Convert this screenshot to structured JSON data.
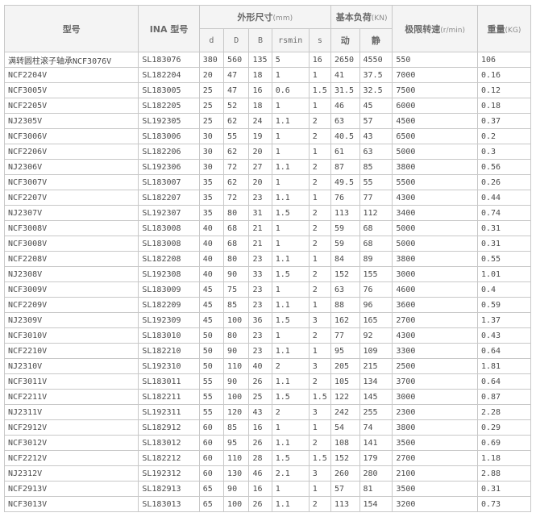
{
  "headers": {
    "model": "型号",
    "ina_model": "INA 型号",
    "dimensions": "外形尺寸",
    "dimensions_unit": "(mm)",
    "load": "基本负荷",
    "load_unit": "(KN)",
    "speed": "极限转速",
    "speed_unit": "(r/min)",
    "weight": "重量",
    "weight_unit": "(KG)",
    "d": "d",
    "D": "D",
    "B": "B",
    "rsmin": "rsmin",
    "s": "s",
    "dynamic": "动",
    "static": "静"
  },
  "rows": [
    [
      "满转圆柱滚子轴承NCF3076V",
      "SL183076",
      "380",
      "560",
      "135",
      "5",
      "16",
      "2650",
      "4550",
      "550",
      "106"
    ],
    [
      "NCF2204V",
      "SL182204",
      "20",
      "47",
      "18",
      "1",
      "1",
      "41",
      "37.5",
      "7000",
      "0.16"
    ],
    [
      "NCF3005V",
      "SL183005",
      "25",
      "47",
      "16",
      "0.6",
      "1.5",
      "31.5",
      "32.5",
      "7500",
      "0.12"
    ],
    [
      "NCF2205V",
      "SL182205",
      "25",
      "52",
      "18",
      "1",
      "1",
      "46",
      "45",
      "6000",
      "0.18"
    ],
    [
      "NJ2305V",
      "SL192305",
      "25",
      "62",
      "24",
      "1.1",
      "2",
      "63",
      "57",
      "4500",
      "0.37"
    ],
    [
      "NCF3006V",
      "SL183006",
      "30",
      "55",
      "19",
      "1",
      "2",
      "40.5",
      "43",
      "6500",
      "0.2"
    ],
    [
      "NCF2206V",
      "SL182206",
      "30",
      "62",
      "20",
      "1",
      "1",
      "61",
      "63",
      "5000",
      "0.3"
    ],
    [
      "NJ2306V",
      "SL192306",
      "30",
      "72",
      "27",
      "1.1",
      "2",
      "87",
      "85",
      "3800",
      "0.56"
    ],
    [
      "NCF3007V",
      "SL183007",
      "35",
      "62",
      "20",
      "1",
      "2",
      "49.5",
      "55",
      "5500",
      "0.26"
    ],
    [
      "NCF2207V",
      "SL182207",
      "35",
      "72",
      "23",
      "1.1",
      "1",
      "76",
      "77",
      "4300",
      "0.44"
    ],
    [
      "NJ2307V",
      "SL192307",
      "35",
      "80",
      "31",
      "1.5",
      "2",
      "113",
      "112",
      "3400",
      "0.74"
    ],
    [
      "NCF3008V",
      "SL183008",
      "40",
      "68",
      "21",
      "1",
      "2",
      "59",
      "68",
      "5000",
      "0.31"
    ],
    [
      "NCF3008V",
      "SL183008",
      "40",
      "68",
      "21",
      "1",
      "2",
      "59",
      "68",
      "5000",
      "0.31"
    ],
    [
      "NCF2208V",
      "SL182208",
      "40",
      "80",
      "23",
      "1.1",
      "1",
      "84",
      "89",
      "3800",
      "0.55"
    ],
    [
      "NJ2308V",
      "SL192308",
      "40",
      "90",
      "33",
      "1.5",
      "2",
      "152",
      "155",
      "3000",
      "1.01"
    ],
    [
      "NCF3009V",
      "SL183009",
      "45",
      "75",
      "23",
      "1",
      "2",
      "63",
      "76",
      "4600",
      "0.4"
    ],
    [
      "NCF2209V",
      "SL182209",
      "45",
      "85",
      "23",
      "1.1",
      "1",
      "88",
      "96",
      "3600",
      "0.59"
    ],
    [
      "NJ2309V",
      "SL192309",
      "45",
      "100",
      "36",
      "1.5",
      "3",
      "162",
      "165",
      "2700",
      "1.37"
    ],
    [
      "NCF3010V",
      "SL183010",
      "50",
      "80",
      "23",
      "1",
      "2",
      "77",
      "92",
      "4300",
      "0.43"
    ],
    [
      "NCF2210V",
      "SL182210",
      "50",
      "90",
      "23",
      "1.1",
      "1",
      "95",
      "109",
      "3300",
      "0.64"
    ],
    [
      "NJ2310V",
      "SL192310",
      "50",
      "110",
      "40",
      "2",
      "3",
      "205",
      "215",
      "2500",
      "1.81"
    ],
    [
      "NCF3011V",
      "SL183011",
      "55",
      "90",
      "26",
      "1.1",
      "2",
      "105",
      "134",
      "3700",
      "0.64"
    ],
    [
      "NCF2211V",
      "SL182211",
      "55",
      "100",
      "25",
      "1.5",
      "1.5",
      "122",
      "145",
      "3000",
      "0.87"
    ],
    [
      "NJ2311V",
      "SL192311",
      "55",
      "120",
      "43",
      "2",
      "3",
      "242",
      "255",
      "2300",
      "2.28"
    ],
    [
      "NCF2912V",
      "SL182912",
      "60",
      "85",
      "16",
      "1",
      "1",
      "54",
      "74",
      "3800",
      "0.29"
    ],
    [
      "NCF3012V",
      "SL183012",
      "60",
      "95",
      "26",
      "1.1",
      "2",
      "108",
      "141",
      "3500",
      "0.69"
    ],
    [
      "NCF2212V",
      "SL182212",
      "60",
      "110",
      "28",
      "1.5",
      "1.5",
      "152",
      "179",
      "2700",
      "1.18"
    ],
    [
      "NJ2312V",
      "SL192312",
      "60",
      "130",
      "46",
      "2.1",
      "3",
      "260",
      "280",
      "2100",
      "2.88"
    ],
    [
      "NCF2913V",
      "SL182913",
      "65",
      "90",
      "16",
      "1",
      "1",
      "57",
      "81",
      "3500",
      "0.31"
    ],
    [
      "NCF3013V",
      "SL183013",
      "65",
      "100",
      "26",
      "1.1",
      "2",
      "113",
      "154",
      "3200",
      "0.73"
    ]
  ]
}
